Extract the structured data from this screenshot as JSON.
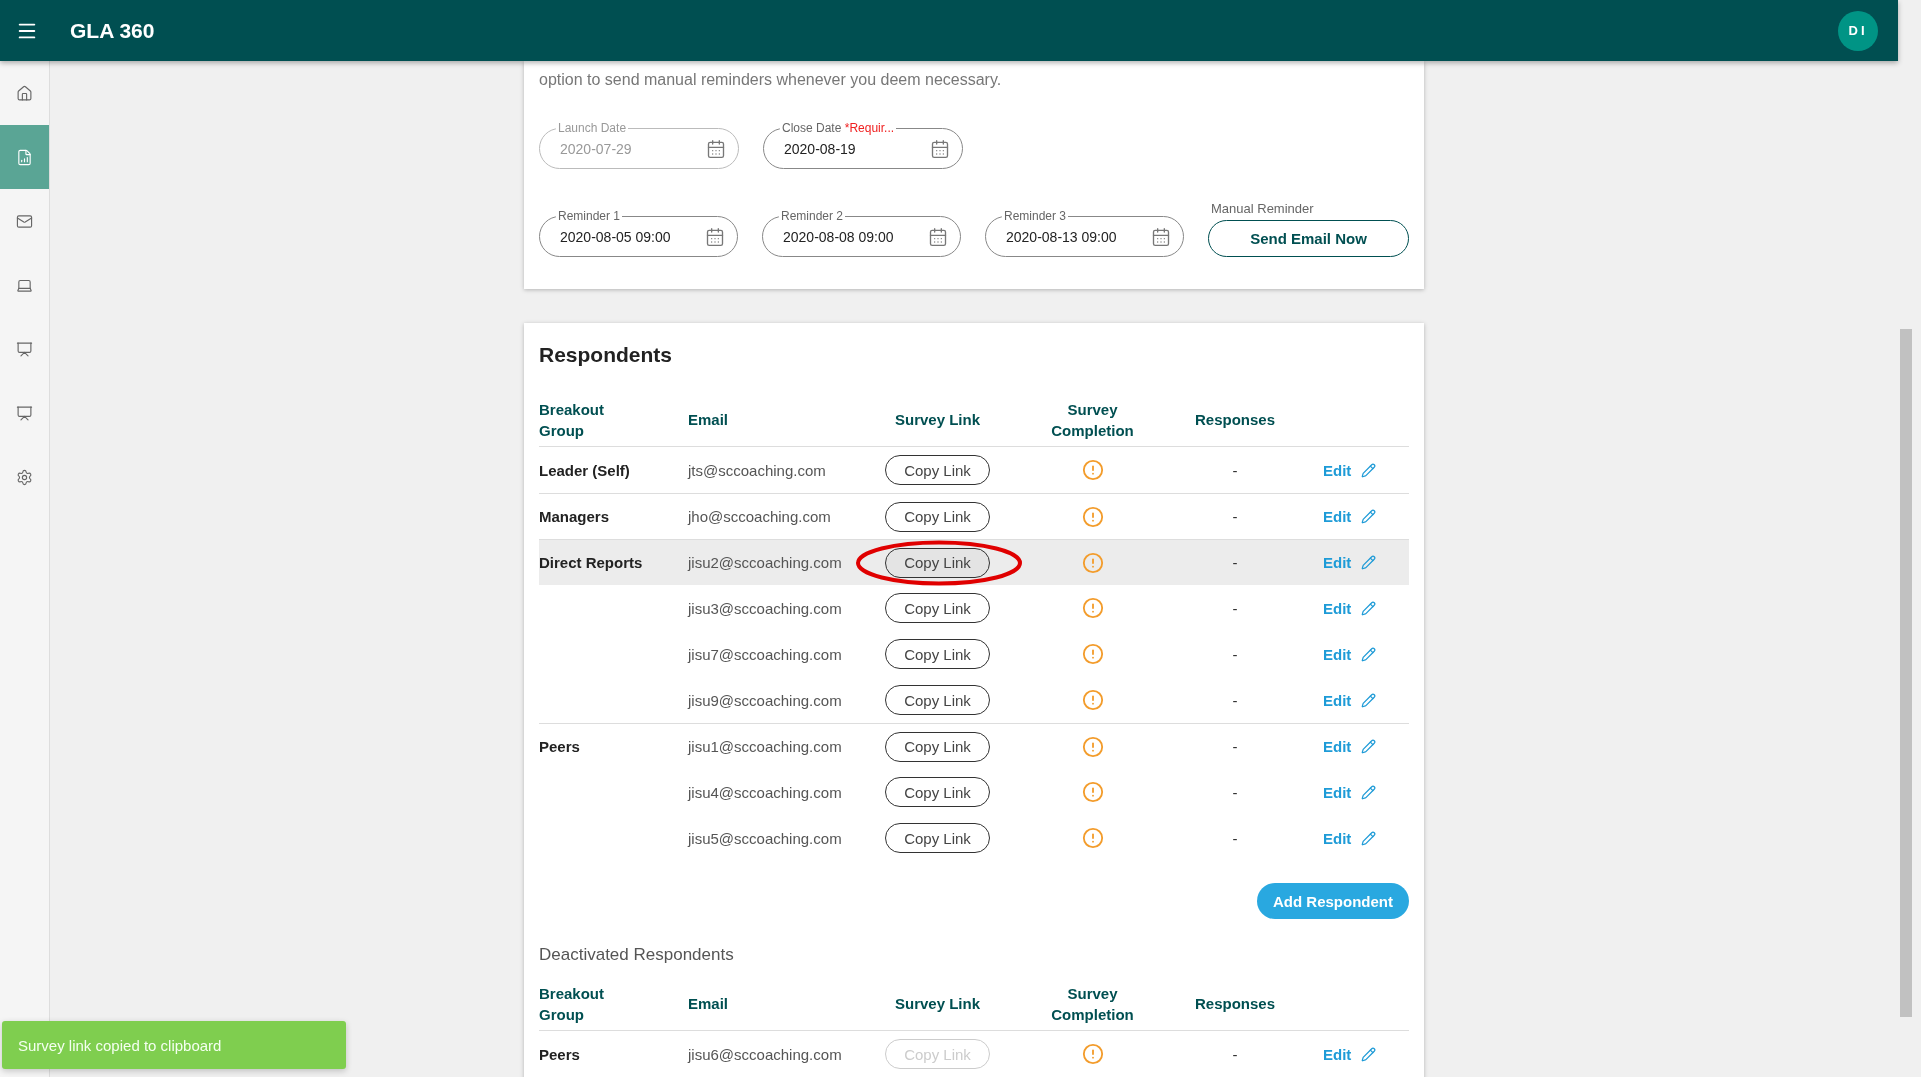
{
  "header": {
    "title": "GLA 360",
    "avatar": "DI"
  },
  "sidebar": {
    "items": [
      {
        "kind": "home",
        "selected": false
      },
      {
        "kind": "report",
        "selected": true
      },
      {
        "kind": "mail",
        "selected": false
      },
      {
        "kind": "laptop",
        "selected": false
      },
      {
        "kind": "presentation",
        "selected": false
      },
      {
        "kind": "presentation",
        "selected": false
      },
      {
        "kind": "settings",
        "selected": false
      }
    ]
  },
  "schedule": {
    "description": "option to send manual reminders whenever you deem necessary.",
    "dates": [
      {
        "label": "Launch Date",
        "value": "2020-07-29",
        "disabled": true
      },
      {
        "label": "Close Date",
        "required_note": "*Requir...",
        "value": "2020-08-19",
        "disabled": false
      }
    ],
    "reminders": [
      {
        "label": "Reminder 1",
        "value": "2020-08-05 09:00",
        "disabled": false
      },
      {
        "label": "Reminder 2",
        "value": "2020-08-08 09:00",
        "disabled": false
      },
      {
        "label": "Reminder 3",
        "value": "2020-08-13 09:00",
        "disabled": false
      }
    ],
    "manual_reminder": {
      "label": "Manual Reminder",
      "button": "Send Email Now"
    }
  },
  "respondents": {
    "title": "Respondents",
    "columns": [
      "Breakout Group",
      "Email",
      "Survey Link",
      "Survey Completion",
      "Responses"
    ],
    "groups": [
      {
        "name": "Leader (Self)",
        "rows": [
          {
            "email": "jts@sccoaching.com",
            "link": "Copy Link",
            "responses": "-",
            "edit": "Edit",
            "selected": false,
            "circled": false
          }
        ]
      },
      {
        "name": "Managers",
        "rows": [
          {
            "email": "jho@sccoaching.com",
            "link": "Copy Link",
            "responses": "-",
            "edit": "Edit",
            "selected": false,
            "circled": false
          }
        ]
      },
      {
        "name": "Direct Reports",
        "rows": [
          {
            "email": "jisu2@sccoaching.com",
            "link": "Copy Link",
            "responses": "-",
            "edit": "Edit",
            "selected": true,
            "circled": true
          },
          {
            "email": "jisu3@sccoaching.com",
            "link": "Copy Link",
            "responses": "-",
            "edit": "Edit",
            "selected": false,
            "circled": false
          },
          {
            "email": "jisu7@sccoaching.com",
            "link": "Copy Link",
            "responses": "-",
            "edit": "Edit",
            "selected": false,
            "circled": false
          },
          {
            "email": "jisu9@sccoaching.com",
            "link": "Copy Link",
            "responses": "-",
            "edit": "Edit",
            "selected": false,
            "circled": false
          }
        ]
      },
      {
        "name": "Peers",
        "rows": [
          {
            "email": "jisu1@sccoaching.com",
            "link": "Copy Link",
            "responses": "-",
            "edit": "Edit",
            "selected": false,
            "circled": false
          },
          {
            "email": "jisu4@sccoaching.com",
            "link": "Copy Link",
            "responses": "-",
            "edit": "Edit",
            "selected": false,
            "circled": false
          },
          {
            "email": "jisu5@sccoaching.com",
            "link": "Copy Link",
            "responses": "-",
            "edit": "Edit",
            "selected": false,
            "circled": false
          }
        ]
      }
    ],
    "add_button": "Add Respondent"
  },
  "deactivated": {
    "title": "Deactivated Respondents",
    "columns": [
      "Breakout Group",
      "Email",
      "Survey Link",
      "Survey Completion",
      "Responses"
    ],
    "groups": [
      {
        "name": "Peers",
        "rows": [
          {
            "email": "jisu6@sccoaching.com",
            "link": "Copy Link",
            "disabled": true,
            "responses": "-",
            "edit": "Edit",
            "selected": false,
            "circled": false
          }
        ]
      }
    ]
  },
  "toast": {
    "text": "Survey link copied to clipboard"
  }
}
